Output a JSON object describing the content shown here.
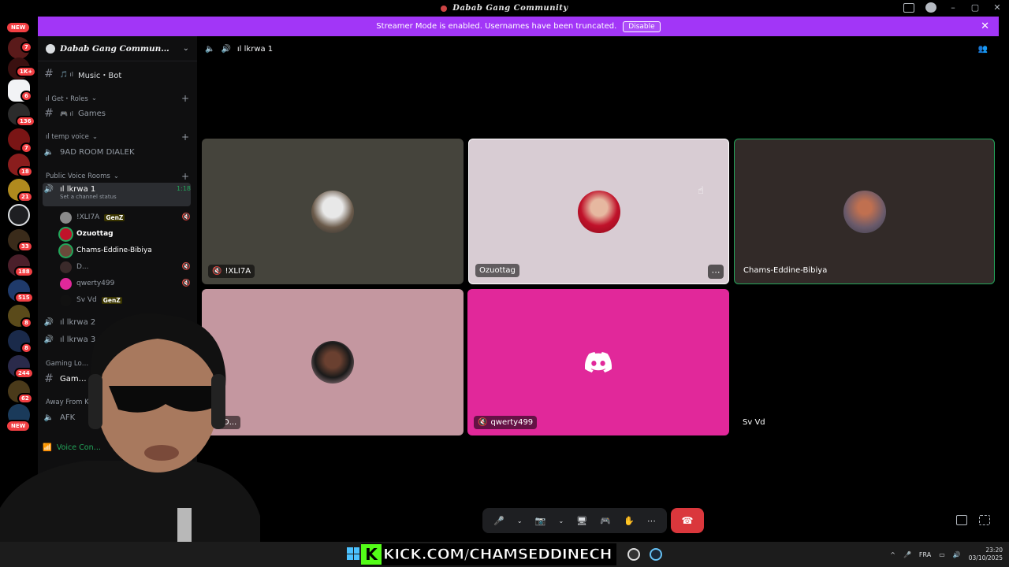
{
  "window": {
    "title": "Dabab Gang Community"
  },
  "banner": {
    "text": "Streamer Mode is enabled. Usernames have been truncated.",
    "button": "Disable"
  },
  "servers": {
    "badges": [
      "7",
      "1K+",
      "6",
      "136",
      "7",
      "18",
      "21",
      "33",
      "188",
      "515",
      "8",
      "8",
      "244",
      "62"
    ],
    "new_top": "NEW",
    "new_bottom": "NEW",
    "vip": "VIP"
  },
  "sidebar": {
    "guild_name": "Dabab Gang Commun…",
    "channels": [
      {
        "type": "text",
        "prefix": "🎵 ıl",
        "label": "Music・Bot"
      },
      {
        "type": "category",
        "label": "ıl Get・Roles"
      },
      {
        "type": "text",
        "prefix": "🎮 ıl",
        "label": "Games"
      },
      {
        "type": "category",
        "label": "ıl temp voice"
      },
      {
        "type": "voice",
        "label": "9AD ROOM DIALEK"
      },
      {
        "type": "category",
        "label": "Public Voice Rooms"
      },
      {
        "type": "voice",
        "label": "ıl lkrwa 1",
        "time": "1:18",
        "status": "Set a channel status"
      },
      {
        "type": "voice",
        "label": "ıl lkrwa 2"
      },
      {
        "type": "voice",
        "label": "ıl lkrwa 3"
      },
      {
        "type": "category",
        "label": "Gaming Lo…"
      },
      {
        "type": "text",
        "label": "Gam…"
      },
      {
        "type": "category",
        "label": "Away From K…"
      },
      {
        "type": "voice",
        "label": "AFK"
      }
    ],
    "members": [
      {
        "name": "!XLI7A",
        "tag": "GenZ"
      },
      {
        "name": "Ozuottag",
        "tag": ""
      },
      {
        "name": "Chams-Eddine-Bibiya",
        "tag": ""
      },
      {
        "name": "D...",
        "tag": ""
      },
      {
        "name": "qwerty499",
        "tag": ""
      },
      {
        "name": "Sv Vd",
        "tag": "GenZ"
      }
    ],
    "voice_connected": "Voice Con…"
  },
  "voice": {
    "channel": "ıl lkrwa 1",
    "tiles": [
      {
        "name": "!XLI7A",
        "bg": "#45443c",
        "muted": true
      },
      {
        "name": "Ozuottag",
        "bg": "#d8ccd3",
        "muted": false
      },
      {
        "name": "Chams-Eddine-Bibiya",
        "bg": "#322a28",
        "muted": false
      },
      {
        "name": "D...",
        "bg": "#c497a0",
        "muted": false
      },
      {
        "name": "qwerty499",
        "bg": "#e1289a",
        "muted": true
      },
      {
        "name": "Sv Vd",
        "bg": "#000000",
        "muted": false
      }
    ]
  },
  "taskbar": {
    "overlay": "KICK.COM/CHAMSEDDINECH",
    "lang": "FRA",
    "time": "23:20",
    "date": "03/10/2025"
  },
  "colors": {
    "streamer_banner": "#a236f7",
    "leave": "#da373c",
    "speaking": "#23a55a",
    "kick": "#53fc18"
  }
}
